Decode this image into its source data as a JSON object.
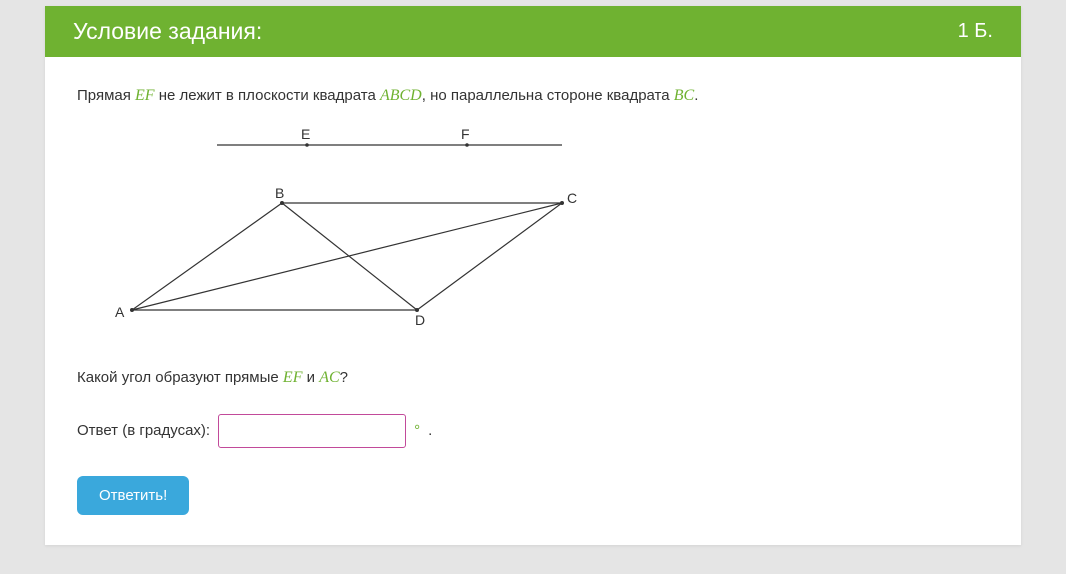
{
  "header": {
    "title": "Условие задания:",
    "score": "1 Б."
  },
  "task": {
    "line1_part1": "Прямая ",
    "line1_math1": "EF",
    "line1_part2": " не лежит в плоскости квадрата ",
    "line1_math2": "ABCD",
    "line1_part3": ", но параллельна стороне квадрата ",
    "line1_math3": "BC",
    "line1_part4": "."
  },
  "diagram": {
    "labels": {
      "A": "A",
      "B": "B",
      "C": "C",
      "D": "D",
      "E": "E",
      "F": "F"
    }
  },
  "question2": {
    "part1": "Какой угол образуют прямые ",
    "math1": "EF",
    "part2": " и ",
    "math2": "AC",
    "part3": "?"
  },
  "answer": {
    "label": "Ответ (в градусах):",
    "value": "",
    "degree_suffix": "°",
    "dot": "."
  },
  "buttons": {
    "submit": "Ответить!"
  }
}
